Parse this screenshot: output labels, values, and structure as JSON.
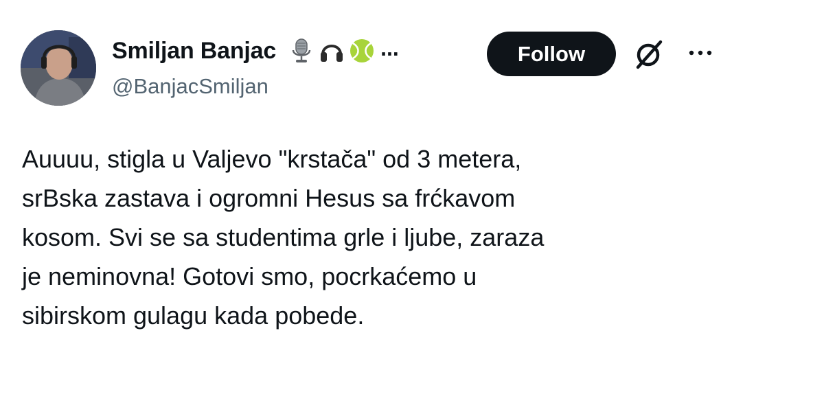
{
  "author": {
    "display_name": "Smiljan Banjac",
    "handle": "@BanjacSmiljan",
    "emojis": [
      "microphone-icon",
      "headphones-icon",
      "tennis-ball-icon"
    ],
    "truncation": "..."
  },
  "actions": {
    "follow_label": "Follow",
    "grok_icon": "grok-icon",
    "more_icon": "more-icon"
  },
  "tweet": {
    "text": "Auuuu, stigla u Valjevo \"krstača\" od 3 metera,\nsrBska zastava i ogromni Hesus sa frćkavom\nkosom. Svi se sa studentima grle i ljube, zaraza\nje neminovna! Gotovi smo, pocrkaćemo u\nsibirskom gulagu kada pobede."
  },
  "colors": {
    "text": "#0f1419",
    "secondary": "#536471",
    "button_bg": "#0f1419",
    "button_text": "#ffffff"
  }
}
